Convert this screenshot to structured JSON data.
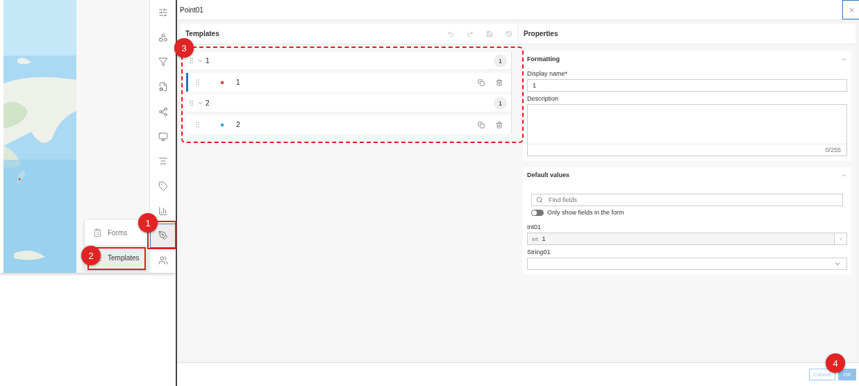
{
  "side_toolbar": {
    "items": [
      {
        "selected": false
      },
      {
        "selected": false
      },
      {
        "selected": false
      },
      {
        "selected": false
      },
      {
        "selected": false
      },
      {
        "selected": false
      },
      {
        "selected": false
      },
      {
        "selected": false
      },
      {
        "selected": false
      },
      {
        "selected": true
      },
      {
        "selected": false
      }
    ]
  },
  "menu": [
    {
      "label": "Forms",
      "selected": false
    },
    {
      "label": "Templates",
      "selected": true
    }
  ],
  "dialog": {
    "title": "Point01",
    "templates": {
      "title": "Templates",
      "groups": [
        {
          "label": "1",
          "count": "1",
          "expanded": true,
          "children": [
            {
              "label": "1",
              "color": "#e04040",
              "selected": true
            }
          ]
        },
        {
          "label": "2",
          "count": "1",
          "expanded": true,
          "children": [
            {
              "label": "2",
              "color": "#3aa6d6",
              "selected": false
            }
          ]
        }
      ]
    },
    "properties": {
      "title": "Properties",
      "formatting": {
        "title": "Formatting",
        "expanded": true,
        "display_name_label": "Display name*",
        "display_name_value": "1",
        "description_label": "Description",
        "counter": "0/255"
      },
      "default_values": {
        "title": "Default values",
        "expanded": true,
        "search": {
          "placeholder": "Find fields"
        },
        "toggle": {
          "label": "Only show fields in the form",
          "on": false
        },
        "fields": [
          {
            "kind": "number",
            "label": "Int01",
            "prefix": "int",
            "value": "1"
          },
          {
            "kind": "select",
            "label": "String01"
          }
        ]
      }
    },
    "buttons": [
      {
        "label": "Cancel",
        "kind": "secondary"
      },
      {
        "label": "OK",
        "kind": "primary"
      }
    ]
  },
  "annotations": [
    {
      "number": "1"
    },
    {
      "number": "2"
    },
    {
      "number": "3"
    },
    {
      "number": "4"
    }
  ]
}
